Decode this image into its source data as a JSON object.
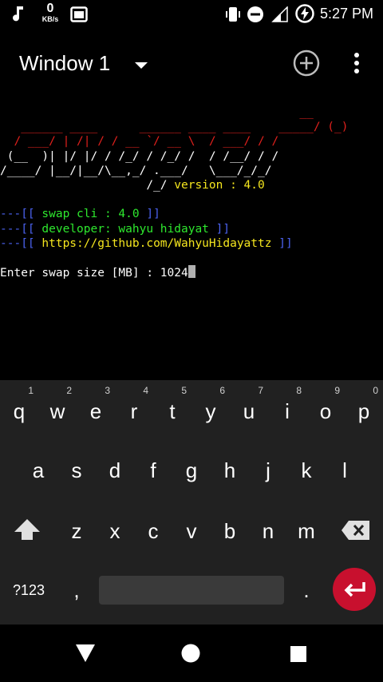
{
  "status_bar": {
    "net_speed_value": "0",
    "net_speed_unit": "KB/s",
    "time": "5:27 PM"
  },
  "app_bar": {
    "window_title": "Window 1"
  },
  "terminal": {
    "banner": [
      "                                           __  ",
      "   ______ ____      ______ ____ ____    _____/ (_)",
      "  / ___/ | /| / / __ `/ __ \\  / ___/ / / ",
      " (__  )| |/ |/ / /_/ / /_/ /  / /__/ / /  ",
      "/____/ |__/|__/\\__,_/ .___/   \\___/_/_/   "
    ],
    "version_prefix": "                     /_/ ",
    "version_text": "version : 4.0",
    "info_prefix": "---[[ ",
    "info_suffix": " ]]",
    "info_lines": [
      "swap cli : 4.0",
      "developer: wahyu hidayat",
      "https://github.com/WahyuHidayattz"
    ],
    "prompt": "Enter swap size [MB] : ",
    "input_value": "1024"
  },
  "keyboard": {
    "row1": [
      {
        "key": "q",
        "hint": "1"
      },
      {
        "key": "w",
        "hint": "2"
      },
      {
        "key": "e",
        "hint": "3"
      },
      {
        "key": "r",
        "hint": "4"
      },
      {
        "key": "t",
        "hint": "5"
      },
      {
        "key": "y",
        "hint": "6"
      },
      {
        "key": "u",
        "hint": "7"
      },
      {
        "key": "i",
        "hint": "8"
      },
      {
        "key": "o",
        "hint": "9"
      },
      {
        "key": "p",
        "hint": "0"
      }
    ],
    "row2": [
      "a",
      "s",
      "d",
      "f",
      "g",
      "h",
      "j",
      "k",
      "l"
    ],
    "row3": [
      "z",
      "x",
      "c",
      "v",
      "b",
      "n",
      "m"
    ],
    "symbols_label": "?123",
    "comma": ",",
    "period": ".",
    "enter_color": "#c8102e"
  },
  "colors": {
    "banner_red": "#e0201c",
    "version_yellow": "#f5e61e",
    "bracket_blue": "#4b62f0",
    "info_green": "#2ee82e"
  }
}
